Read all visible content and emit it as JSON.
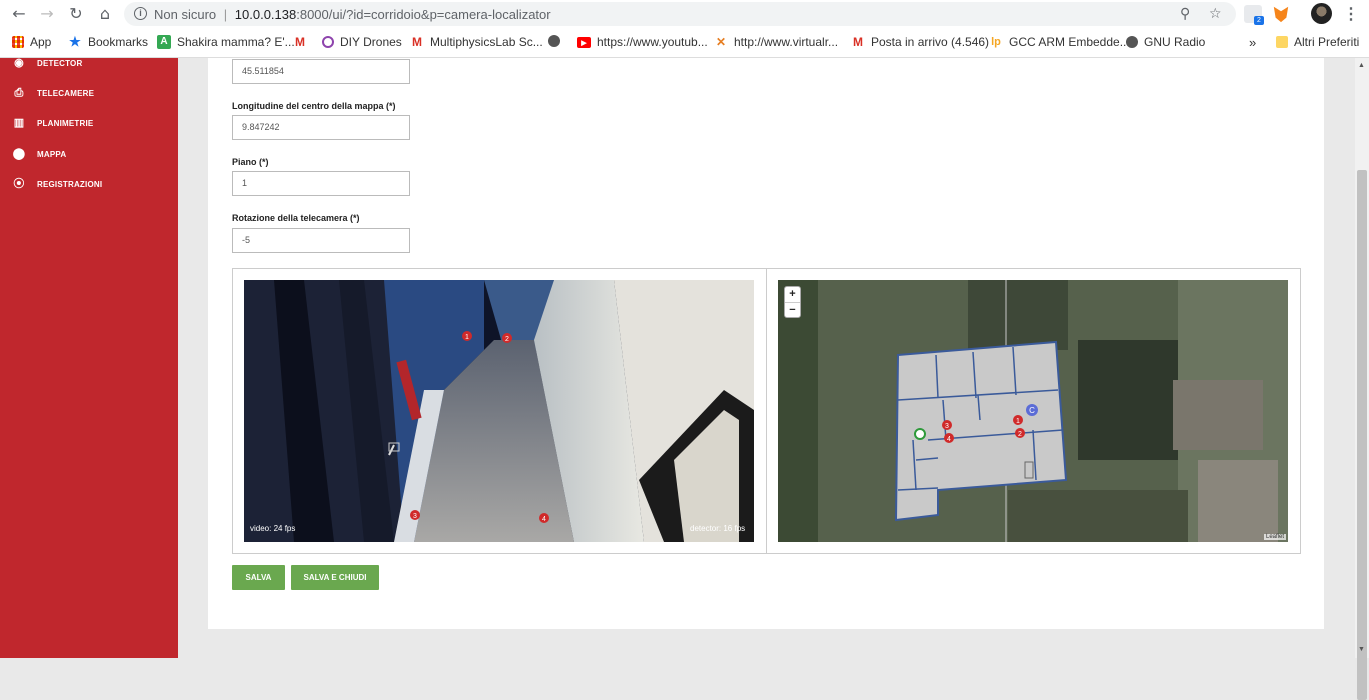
{
  "browser": {
    "nav": {
      "back": "←",
      "forward": "→",
      "reload": "↻",
      "home": "⌂"
    },
    "url_security": "Non sicuro",
    "url_separator": "|",
    "url_host": "10.0.0.138",
    "url_path": ":8000/ui/?id=corridoio&p=camera-localizator",
    "ext_badge": "2",
    "menu": "⋮"
  },
  "bookmarks": {
    "items": [
      {
        "label": "App",
        "icon": "apps-grid-icon"
      },
      {
        "label": "Bookmarks",
        "icon": "star-icon"
      },
      {
        "label": "Shakira mamma? E'...",
        "icon": "a-icon"
      },
      {
        "label": "",
        "icon": "gmail-icon"
      },
      {
        "label": "DIY Drones",
        "icon": "drones-icon"
      },
      {
        "label": "MultiphysicsLab Sc...",
        "icon": "gmail-icon"
      },
      {
        "label": "",
        "icon": "globe-icon"
      },
      {
        "label": "https://www.youtub...",
        "icon": "youtube-icon"
      },
      {
        "label": "http://www.virtualr...",
        "icon": "x-icon"
      },
      {
        "label": "Posta in arrivo (4.546)",
        "icon": "gmail-icon"
      },
      {
        "label": "GCC ARM Embedde...",
        "icon": "lp-icon"
      },
      {
        "label": "GNU Radio",
        "icon": "globe-icon"
      }
    ],
    "more": "»",
    "other": "Altri Preferiti"
  },
  "sidebar": {
    "items": [
      {
        "label": "DETECTOR",
        "icon": "eye-icon"
      },
      {
        "label": "TELECAMERE",
        "icon": "camera-icon"
      },
      {
        "label": "PLANIMETRIE",
        "icon": "map-folded-icon"
      },
      {
        "label": "MAPPA",
        "icon": "map-pin-icon"
      },
      {
        "label": "REGISTRAZIONI",
        "icon": "record-icon"
      }
    ]
  },
  "form": {
    "latitude_value": "45.511854",
    "longitude_label": "Longitudine del centro della mappa (*)",
    "longitude_value": "9.847242",
    "floor_label": "Piano (*)",
    "floor_value": "1",
    "rotation_label": "Rotazione della telecamera (*)",
    "rotation_value": "-5"
  },
  "video": {
    "video_fps": "video: 24 fps",
    "detector_fps": "detector: 16 fps",
    "markers": [
      "1",
      "2",
      "3",
      "4"
    ]
  },
  "map": {
    "zoom_in": "+",
    "zoom_out": "−",
    "attribution": "Leaflet",
    "markers": [
      "1",
      "2",
      "3",
      "4",
      "C"
    ]
  },
  "buttons": {
    "save": "SALVA",
    "save_close": "SALVA E CHIUDI"
  }
}
